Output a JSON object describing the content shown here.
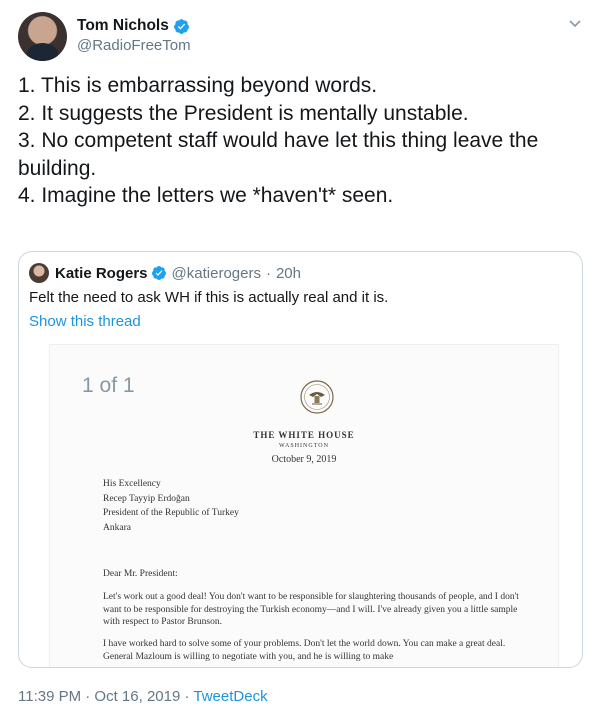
{
  "author": {
    "name": "Tom Nichols",
    "handle": "@RadioFreeTom"
  },
  "tweet": {
    "lines": [
      "1. This is embarrassing beyond words.",
      "2. It suggests the President is mentally unstable.",
      "3. No competent staff would have let this thing leave the building.",
      "4. Imagine the letters we *haven't* seen."
    ]
  },
  "quoted": {
    "name": "Katie Rogers",
    "handle": "@katierogers",
    "time": "20h",
    "text": "Felt the need to ask WH if this is actually real and it is.",
    "thread_link": "Show this thread",
    "media": {
      "page_counter": "1 of 1",
      "letter": {
        "title": "THE WHITE HOUSE",
        "city": "WASHINGTON",
        "date": "October 9, 2019",
        "address": [
          "His Excellency",
          "Recep Tayyip Erdoğan",
          "President of the Republic of Turkey",
          "Ankara"
        ],
        "salutation": "Dear Mr. President:",
        "paragraph1": "Let's work out a good deal! You don't want to be responsible for slaughtering thousands of people, and I don't want to be responsible for destroying the Turkish economy—and I will. I've already given you a little sample with respect to Pastor Brunson.",
        "paragraph2": "I have worked hard to solve some of your problems. Don't let the world down. You can make a great deal. General Mazloum is willing to negotiate with you, and he is willing to make"
      }
    }
  },
  "meta": {
    "timestamp": "11:39 PM · Oct 16, 2019",
    "separator": "·",
    "app": "TweetDeck"
  },
  "colors": {
    "link": "#1b95e0",
    "verified": "#1da1f2",
    "secondary_text": "#657786",
    "border": "#ccd6dd"
  }
}
